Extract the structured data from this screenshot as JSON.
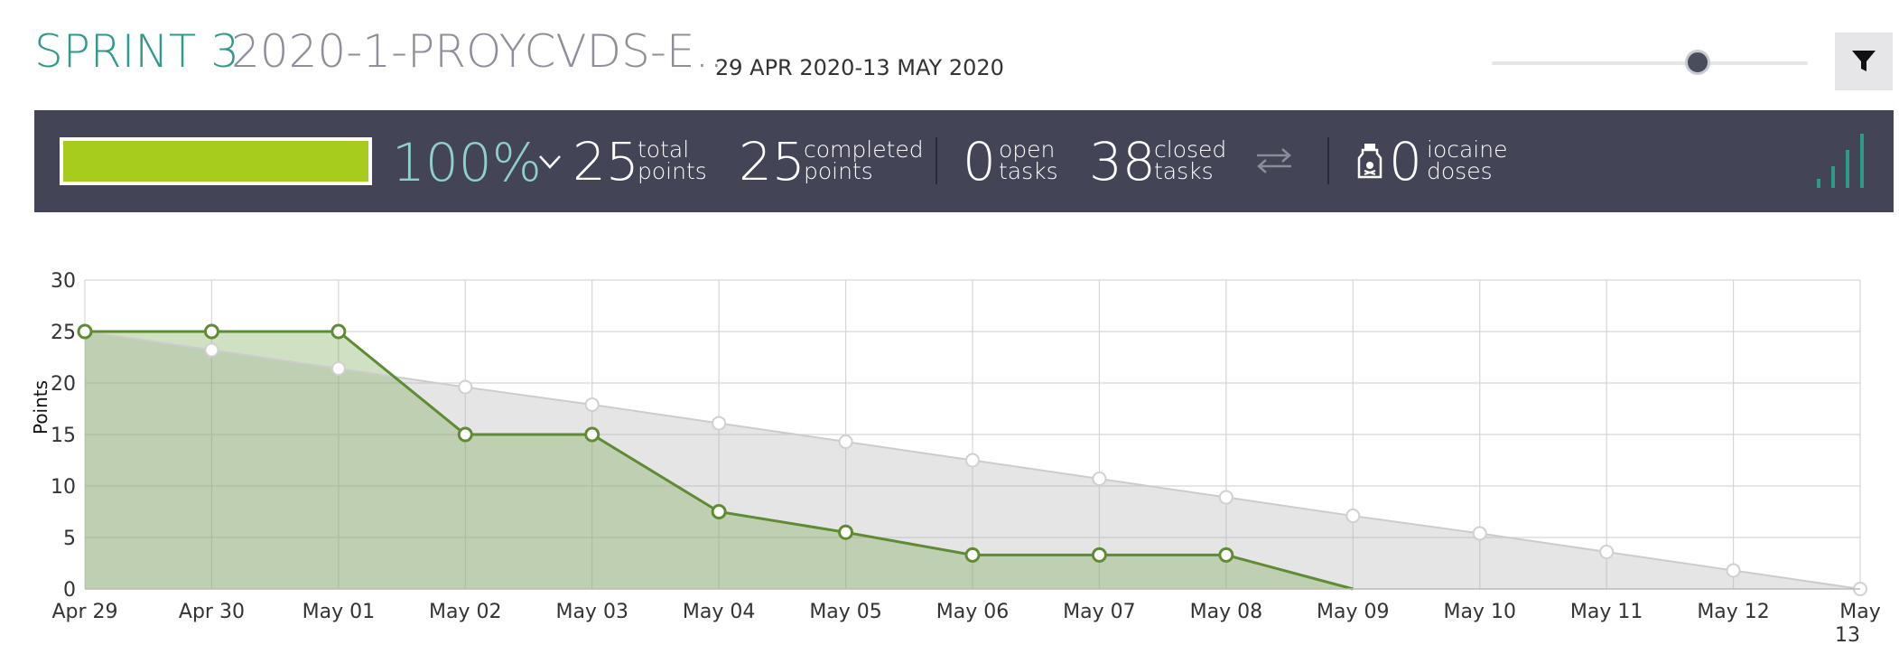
{
  "header": {
    "sprint_name": "SPRINT 3",
    "project_name": "2020-1-PROYCVDS-E...",
    "dates": "29 APR 2020-13 MAY 2020"
  },
  "stats": {
    "progress_percent": 100,
    "percent_label": "100%",
    "total_points": "25",
    "total_points_label_1": "total",
    "total_points_label_2": "points",
    "completed_points": "25",
    "completed_points_label_1": "completed",
    "completed_points_label_2": "points",
    "open_tasks": "0",
    "open_tasks_label_1": "open",
    "open_tasks_label_2": "tasks",
    "closed_tasks": "38",
    "closed_tasks_label_1": "closed",
    "closed_tasks_label_2": "tasks",
    "iocaine_doses": "0",
    "iocaine_label_1": "iocaine",
    "iocaine_label_2": "doses"
  },
  "colors": {
    "accent": "#2e9a8a",
    "stats_bg": "#434556",
    "progress_fill": "#a8cc1e",
    "actual_line": "#5e8b33",
    "ideal_line": "#cccccc"
  },
  "icons": {
    "filter": "filter-icon",
    "chevron": "chevron-down-icon",
    "swap": "swap-arrows-icon",
    "poison": "poison-bottle-icon",
    "signal": "signal-bars-icon"
  },
  "chart_data": {
    "type": "area",
    "ylabel": "Points",
    "ylim": [
      0,
      30
    ],
    "yticks": [
      0,
      5,
      10,
      15,
      20,
      25,
      30
    ],
    "categories": [
      "Apr 29",
      "Apr 30",
      "May 01",
      "May 02",
      "May 03",
      "May 04",
      "May 05",
      "May 06",
      "May 07",
      "May 08",
      "May 09",
      "May 10",
      "May 11",
      "May 12",
      "May 13"
    ],
    "series": [
      {
        "values": [
          25,
          23.2,
          21.4,
          19.6,
          17.9,
          16.1,
          14.3,
          12.5,
          10.7,
          8.9,
          7.1,
          5.4,
          3.6,
          1.8,
          0
        ]
      },
      {
        "values": [
          25,
          25,
          25,
          15,
          15,
          7.5,
          5.5,
          3.3,
          3.3,
          3.3,
          0
        ]
      }
    ],
    "grid": true
  }
}
